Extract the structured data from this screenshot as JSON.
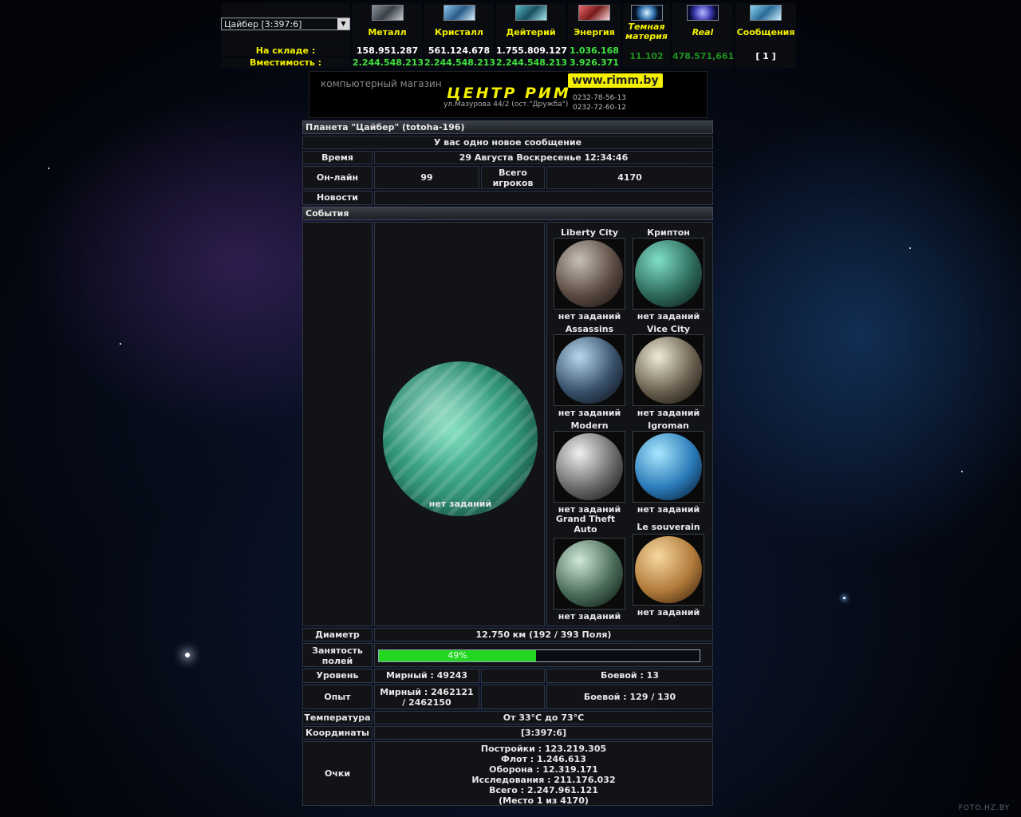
{
  "planet_select": {
    "value": "Цайбер [3:397:6]"
  },
  "resources": [
    {
      "name": "Металл",
      "stock": "158.951.287",
      "capacity": "2.244.548.213",
      "stock_color": "#ffffff",
      "cap_color": "#3fe23f",
      "icon": "metal-icon",
      "italic": false
    },
    {
      "name": "Кристалл",
      "stock": "561.124.678",
      "capacity": "2.244.548.213",
      "stock_color": "#ffffff",
      "cap_color": "#3fe23f",
      "icon": "crystal-icon",
      "italic": false
    },
    {
      "name": "Дейтерий",
      "stock": "1.755.809.127",
      "capacity": "2.244.548.213",
      "stock_color": "#ffffff",
      "cap_color": "#3fe23f",
      "icon": "deuterium-icon",
      "italic": false
    },
    {
      "name": "Энергия",
      "stock": "1.036.168",
      "capacity": "3.926.371",
      "stock_color": "#3fe23f",
      "cap_color": "#3fe23f",
      "icon": "energy-icon",
      "italic": false
    },
    {
      "name": "Темная материя",
      "stock": "11.102",
      "capacity": "",
      "stock_color": "#1f8f1f",
      "cap_color": "#1f8f1f",
      "icon": "dark-matter-icon",
      "italic": true
    },
    {
      "name": "Real",
      "stock": "478.571,661",
      "capacity": "",
      "stock_color": "#1f8f1f",
      "cap_color": "#1f8f1f",
      "icon": "real-icon",
      "italic": true
    },
    {
      "name": "Сообщения",
      "stock": "[ 1 ]",
      "capacity": "",
      "stock_color": "#ffffff",
      "cap_color": "#ffffff",
      "icon": "messages-icon",
      "italic": false
    }
  ],
  "row_labels": {
    "stock": "На складе :",
    "capacity": "Вместимость :"
  },
  "banner": {
    "tagline": "компьютерный магазин",
    "brand": "ЦЕНТР РИМ",
    "url": "www.rimm.by",
    "address": "ул.Мазурова 44/2 (ост.\"Дружба\")",
    "phones": [
      "0232-78-56-13",
      "0232-72-60-12"
    ]
  },
  "overview": {
    "title": "Планета \"Цайбер\" (totoha-196)",
    "new_message": "У вас одно новое сообщение",
    "time_label": "Время",
    "time_value": "29 Августа Воскресенье 12:34:46",
    "online_label": "Он-лайн",
    "online_value": "99",
    "total_players_label": "Всего игроков",
    "total_players_value": "4170",
    "news_label": "Новости",
    "events_label": "События",
    "main_planet_status": "нет заданий",
    "planets": [
      {
        "name": "Liberty City",
        "status": "нет заданий",
        "c1": "#c8c0b8",
        "c2": "#5a4a42",
        "c3": "#1a1410"
      },
      {
        "name": "Криптон",
        "status": "нет заданий",
        "c1": "#7fe0c8",
        "c2": "#2e6a5c",
        "c3": "#0c1c18"
      },
      {
        "name": "Assassins",
        "status": "нет заданий",
        "c1": "#b8d8f0",
        "c2": "#38506a",
        "c3": "#0c1018"
      },
      {
        "name": "Vice City",
        "status": "нет заданий",
        "c1": "#f0ead8",
        "c2": "#6a6050",
        "c3": "#14100a"
      },
      {
        "name": "Modern Warfare",
        "status": "нет заданий",
        "c1": "#f0f0f0",
        "c2": "#6a6a6a",
        "c3": "#141414"
      },
      {
        "name": "Igroman",
        "status": "нет заданий",
        "c1": "#a8e8ff",
        "c2": "#2a7ab8",
        "c3": "#081a30"
      },
      {
        "name": "Grand Theft Auto",
        "status": "нет заданий",
        "c1": "#d0e8d8",
        "c2": "#4a6a58",
        "c3": "#0c1810"
      },
      {
        "name": "Le souverain",
        "status": "нет заданий",
        "c1": "#f8d8a0",
        "c2": "#b07a3a",
        "c3": "#3a220c"
      }
    ],
    "diameter_label": "Диаметр",
    "diameter_value": "12.750 км (192 / 393 Поля)",
    "fields_label": "Занятость полей",
    "fields_percent_text": "49%",
    "fields_fraction": 0.49,
    "level_label": "Уровень",
    "level_peace": "Мирный : 49243",
    "level_combat": "Боевой : 13",
    "exp_label": "Опыт",
    "exp_peace": "Мирный : 2462121 / 2462150",
    "exp_combat": "Боевой : 129 / 130",
    "temp_label": "Температура",
    "temp_value": "От 33°C до 73°C",
    "coords_label": "Координаты",
    "coords_value": "[3:397:6]",
    "points_label": "Очки",
    "points_lines": [
      "Постройки : 123.219.305",
      "Флот : 1.246.613",
      "Оборона : 12.319.171",
      "Исследования : 211.176.032",
      "Всего : 2.247.961.121",
      "(Место 1 из 4170)"
    ]
  },
  "footer": "FOTO.HZ.BY",
  "colors": {
    "accent_yellow": "#f4f000",
    "bar_green": "#22d622"
  }
}
